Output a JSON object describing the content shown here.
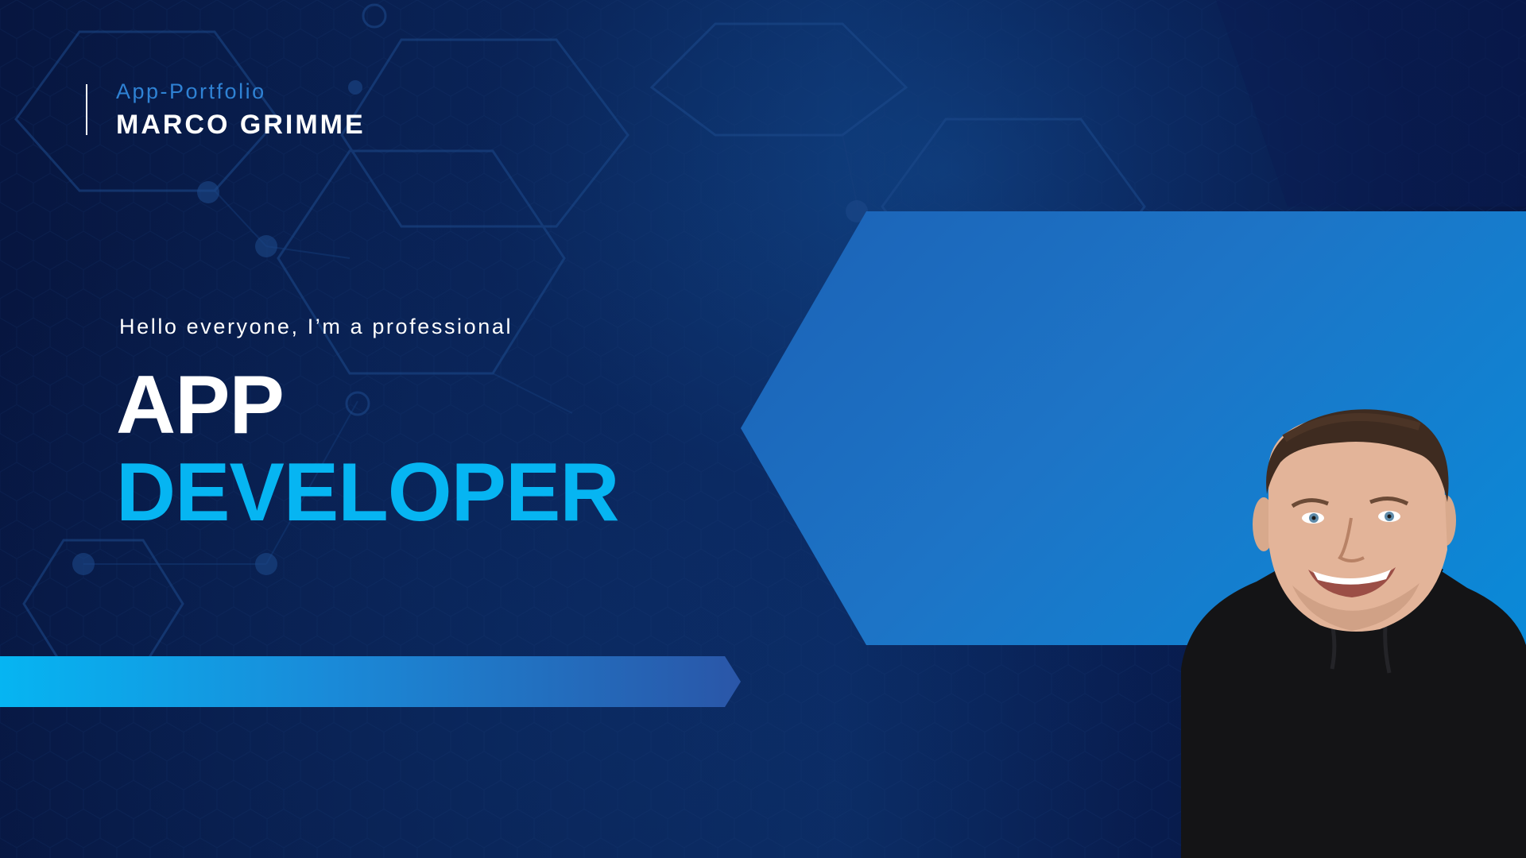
{
  "header": {
    "subtitle": "App-Portfolio",
    "name": "MARCO GRIMME"
  },
  "hero": {
    "intro": "Hello everyone, I’m a professional",
    "title_line1": "APP",
    "title_line2": "DEVELOPER"
  },
  "colors": {
    "background": "#07163d",
    "accent_cyan": "#06b5f2",
    "panel_blue": "#1d74c6",
    "subtitle_blue": "#2f82d4",
    "text_white": "#ffffff"
  }
}
